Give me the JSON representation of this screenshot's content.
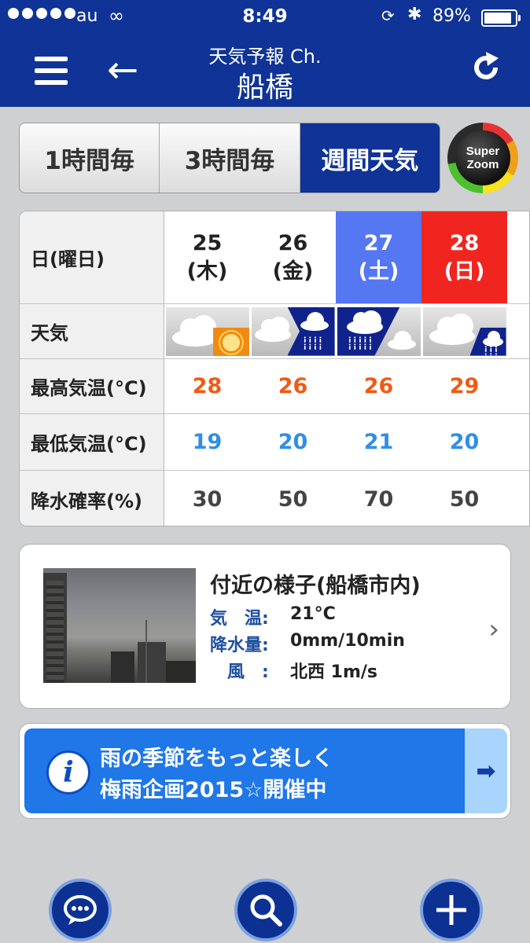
{
  "status_bar": {
    "carrier": "au",
    "time": "8:49",
    "battery_text": "89%",
    "battery_level": 0.89
  },
  "header": {
    "subtitle": "天気予報 Ch.",
    "title": "船橋"
  },
  "tabs": [
    {
      "label": "1時間毎",
      "active": false
    },
    {
      "label": "3時間毎",
      "active": false
    },
    {
      "label": "週間天気",
      "active": true
    }
  ],
  "super_zoom": {
    "line1": "Super",
    "line2": "Zoom"
  },
  "weekly": {
    "row_labels": {
      "date": "日(曜日)",
      "weather": "天気",
      "high": "最高気温(°C)",
      "low": "最低気温(°C)",
      "precip": "降水確率(%)"
    },
    "days": [
      {
        "date": "25",
        "weekday": "(木)",
        "weather": "cloudy-then-sunny",
        "high": "28",
        "low": "19",
        "precip": "30",
        "highlight": "none"
      },
      {
        "date": "26",
        "weekday": "(金)",
        "weather": "cloudy-then-rain",
        "high": "26",
        "low": "20",
        "precip": "50",
        "highlight": "none"
      },
      {
        "date": "27",
        "weekday": "(土)",
        "weather": "rain-then-cloudy",
        "high": "26",
        "low": "21",
        "precip": "70",
        "highlight": "saturday"
      },
      {
        "date": "28",
        "weekday": "(日)",
        "weather": "cloudy-with-rain",
        "high": "29",
        "low": "20",
        "precip": "50",
        "highlight": "sunday"
      }
    ],
    "colors": {
      "saturday": "#5577f2",
      "sunday": "#f0251f",
      "high": "#f05a14",
      "low": "#2f8fe8"
    }
  },
  "nearby": {
    "title": "付近の様子(船橋市内)",
    "temp_label": "気　温:",
    "temp_value": "21°C",
    "rain_label": "降水量:",
    "rain_value": "0mm/10min",
    "wind_label": "　風　:",
    "wind_value": "北西 1m/s"
  },
  "banner": {
    "line1": "雨の季節をもっと楽しく",
    "line2": "梅雨企画2015☆開催中"
  },
  "bottom_buttons": [
    {
      "icon": "chat-icon"
    },
    {
      "icon": "search-icon"
    },
    {
      "icon": "plus-icon"
    }
  ]
}
